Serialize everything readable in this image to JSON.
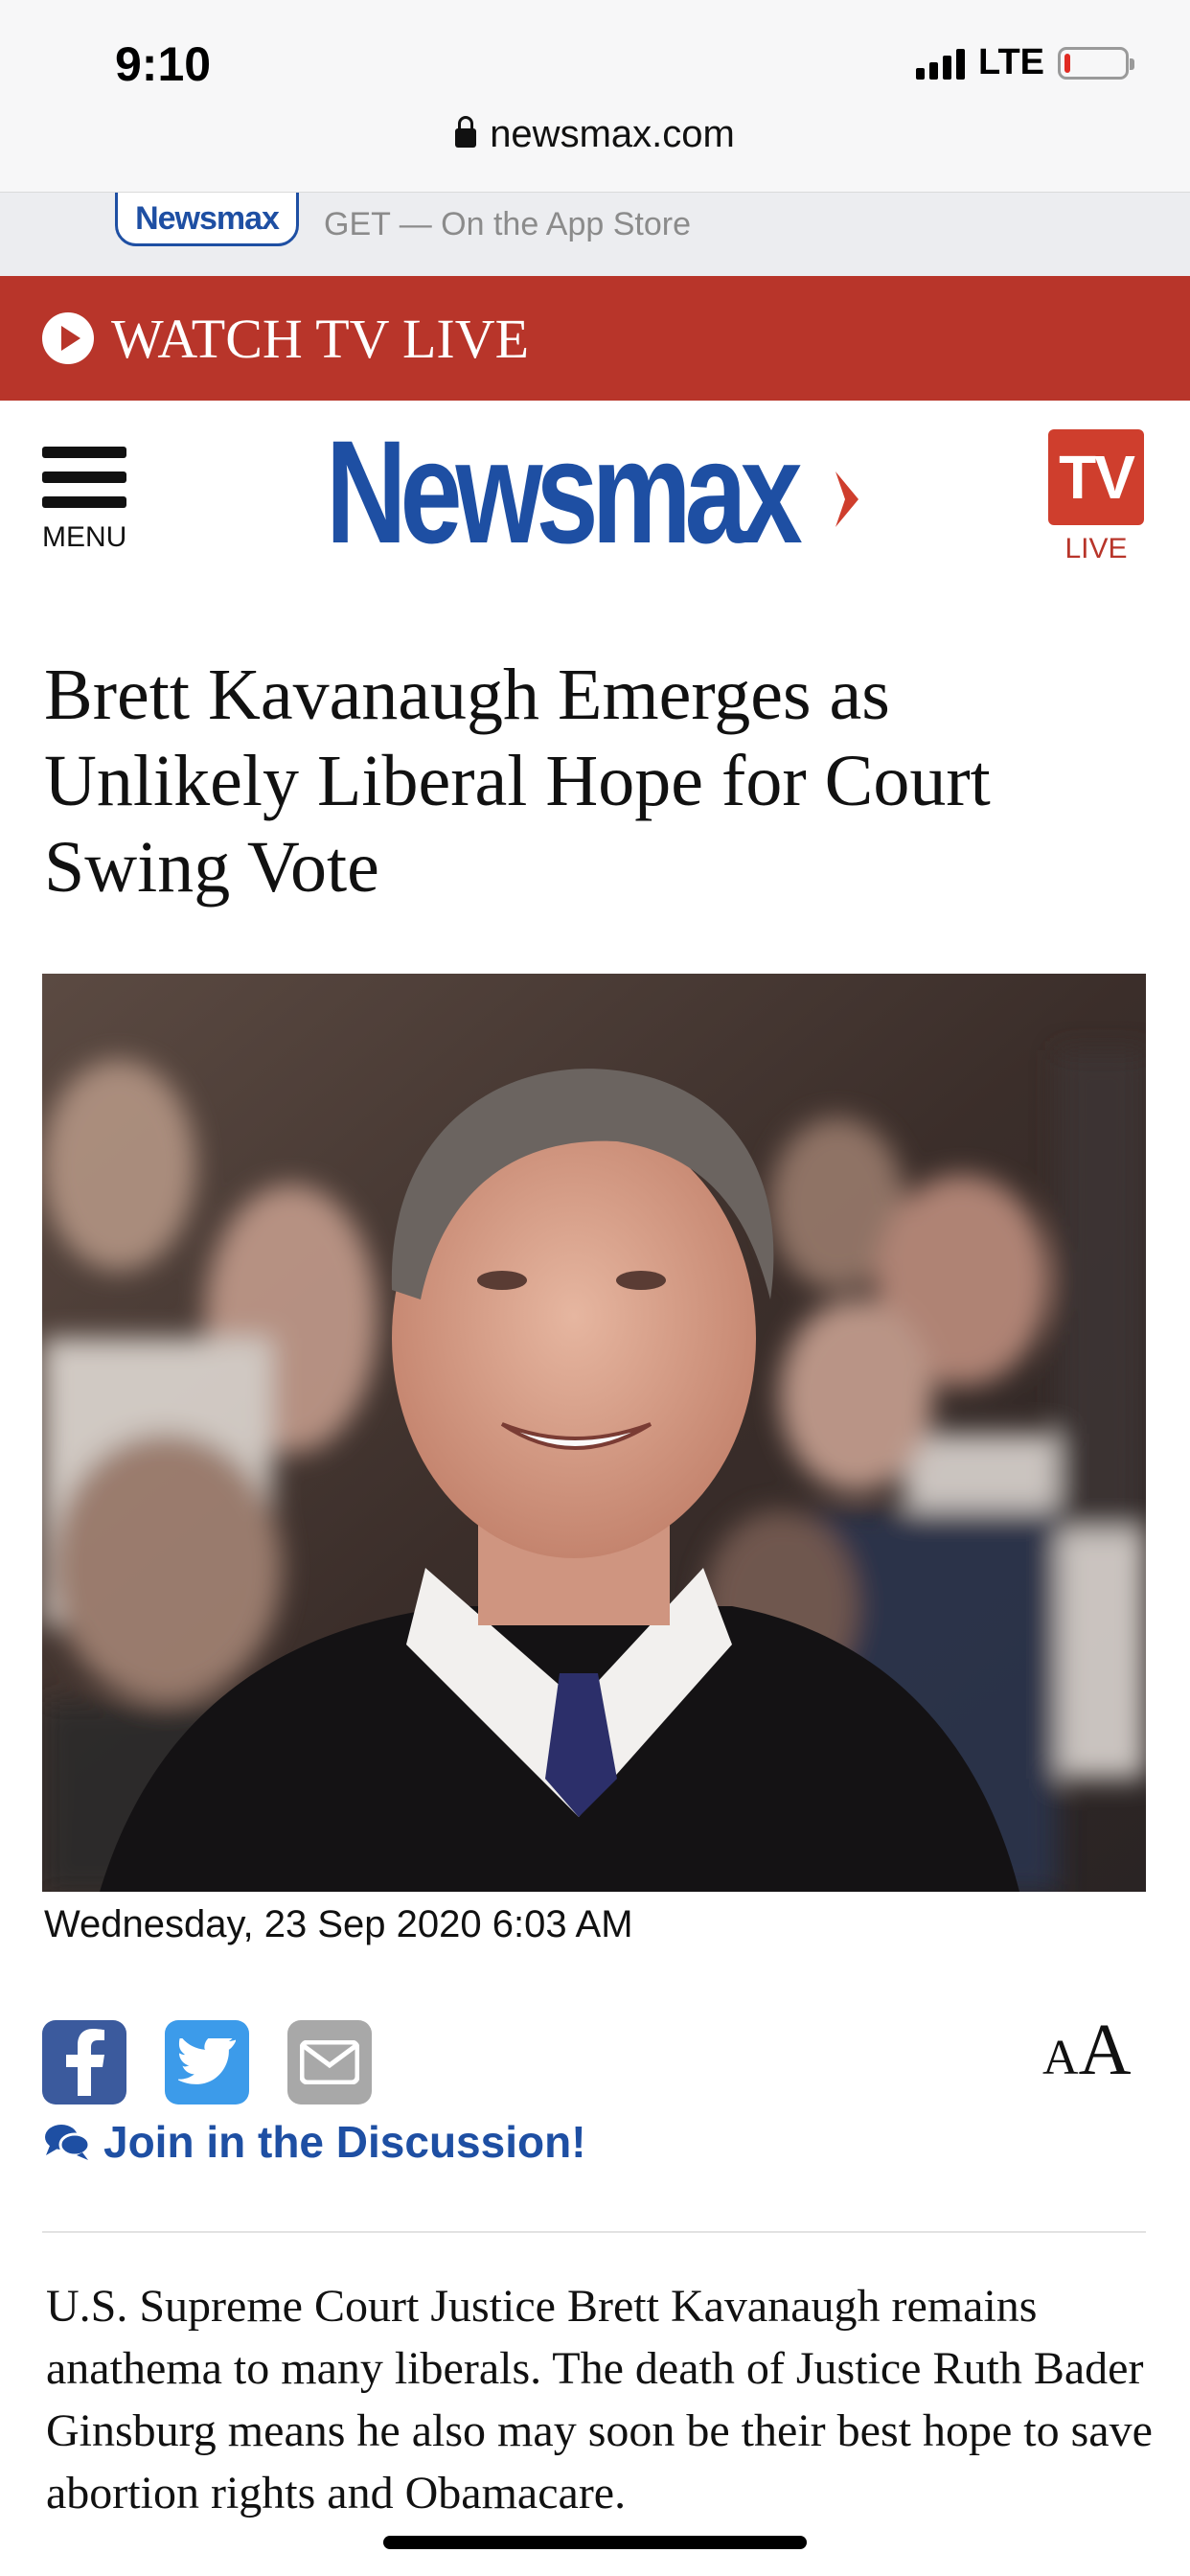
{
  "status_bar": {
    "time": "9:10",
    "network": "LTE",
    "battery_level": 0.1
  },
  "browser": {
    "url": "newsmax.com"
  },
  "app_banner": {
    "app_name": "Newsmax",
    "cta": "GET — On the App Store"
  },
  "watch_bar": {
    "label": "WATCH TV LIVE"
  },
  "header": {
    "menu_label": "MENU",
    "logo_text": "Newsmax",
    "tv_label": "TV",
    "live_label": "LIVE"
  },
  "article": {
    "headline": "Brett Kavanaugh Emerges as Unlikely Liberal Hope for Court Swing Vote",
    "date": "Wednesday, 23 Sep 2020 6:03 AM",
    "discussion_label": "Join in the Discussion!",
    "font_size_small": "A",
    "font_size_big": "A",
    "body": "U.S. Supreme Court Justice Brett Kavanaugh remains anathema to many liberals. The death of Justice Ruth Bader Ginsburg means he also may soon be their best hope to save abortion rights and Obamacare."
  },
  "colors": {
    "brand_blue": "#1e4fa3",
    "watch_red": "#b8352a",
    "facebook": "#3b5a9d",
    "twitter": "#3c9bea",
    "email": "#a8a8a8"
  }
}
